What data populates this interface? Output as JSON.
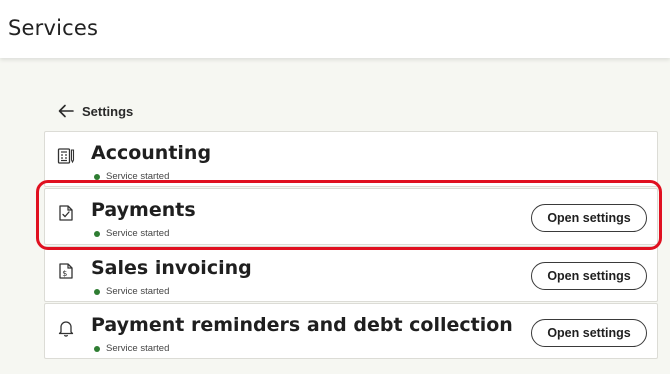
{
  "header": {
    "title": "Services"
  },
  "breadcrumb": {
    "label": "Settings",
    "icon": "arrow-left-icon"
  },
  "services": [
    {
      "title": "Accounting",
      "status": "Service started",
      "icon": "ledger-pen-icon",
      "button": ""
    },
    {
      "title": "Payments",
      "status": "Service started",
      "icon": "document-check-icon",
      "button": "Open settings"
    },
    {
      "title": "Sales invoicing",
      "status": "Service started",
      "icon": "invoice-dollar-icon",
      "button": "Open settings"
    },
    {
      "title": "Payment reminders and debt collection",
      "status": "Service started",
      "icon": "bell-icon",
      "button": "Open settings"
    }
  ],
  "colors": {
    "status_dot": "#2e7d32",
    "highlight": "#e01020"
  }
}
